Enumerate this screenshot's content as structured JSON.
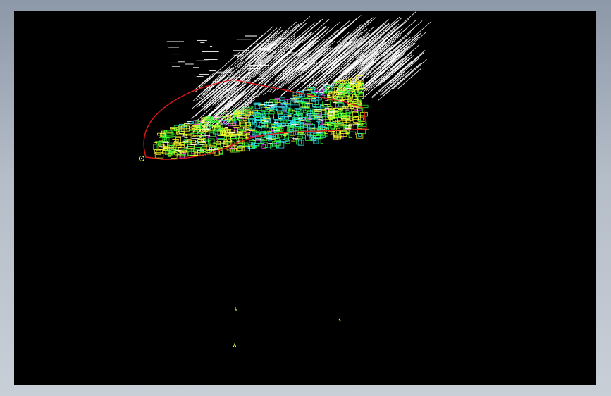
{
  "canvas": {
    "background": "#000000",
    "frame_gradient": [
      "#8d98a8",
      "#c9cfd7"
    ]
  },
  "colors": {
    "boundary": "#e01818",
    "white_hatch": "#ffffff",
    "yellow": "#ffff30",
    "green": "#30ff30",
    "cyan": "#30e8e8",
    "magenta": "#ff30ff",
    "crosshair": "#d8d8d8"
  },
  "icons": {
    "origin_marker": "origin-marker-icon",
    "ucs": "ucs-crosshair-icon"
  }
}
